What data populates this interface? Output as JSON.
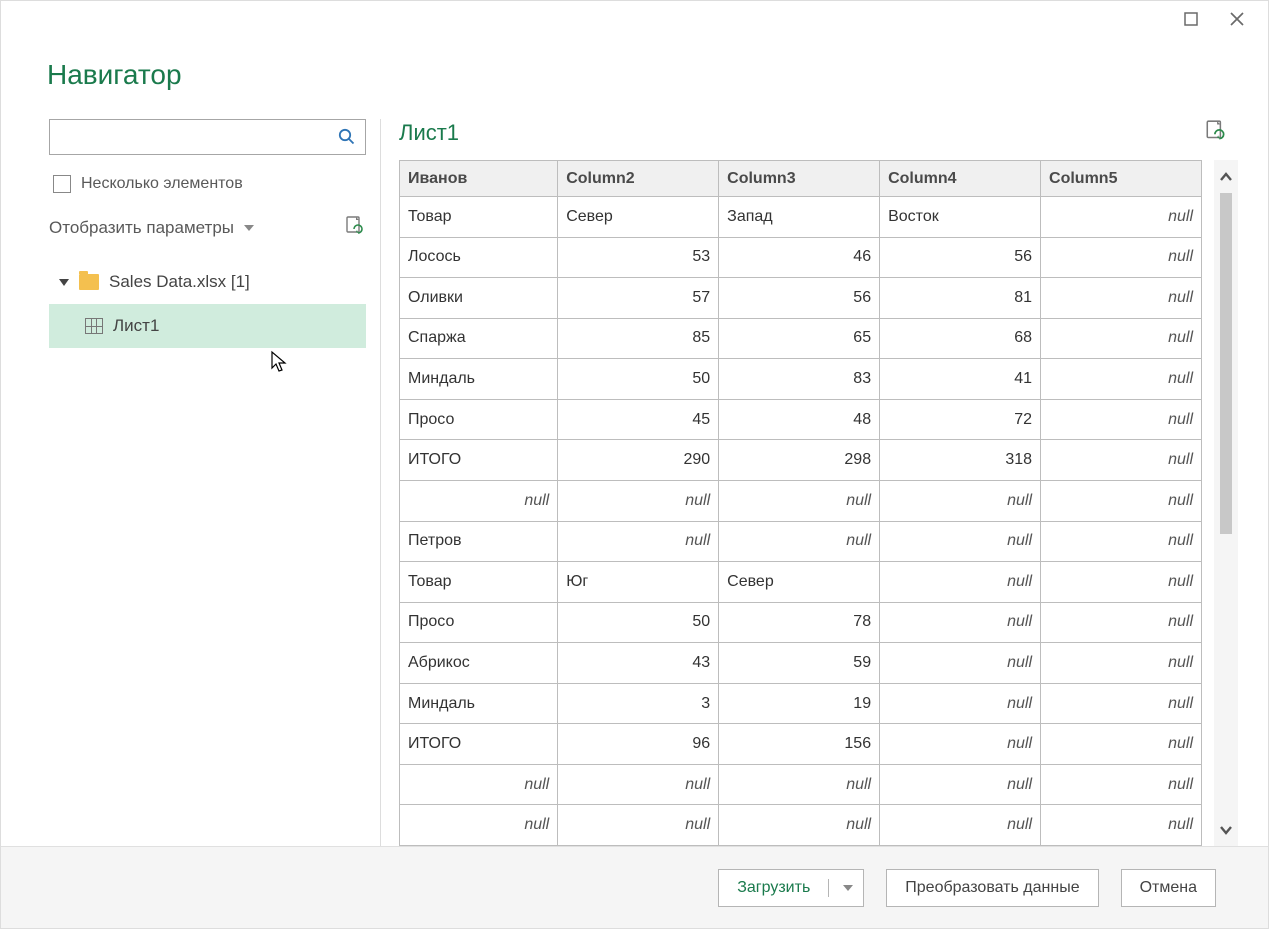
{
  "window": {
    "title": "Навигатор"
  },
  "sidebar": {
    "search_placeholder": "",
    "multi_select_label": "Несколько элементов",
    "display_options_label": "Отобразить параметры",
    "tree": {
      "root_label": "Sales Data.xlsx [1]",
      "sheets": [
        "Лист1"
      ]
    }
  },
  "preview": {
    "title": "Лист1",
    "null_text": "null",
    "columns": [
      "Иванов",
      "Column2",
      "Column3",
      "Column4",
      "Column5"
    ],
    "rows": [
      {
        "c": [
          "Товар",
          "Север",
          "Запад",
          "Восток",
          null
        ],
        "t": [
          "s",
          "s",
          "s",
          "s",
          "n"
        ]
      },
      {
        "c": [
          "Лосось",
          53,
          46,
          56,
          null
        ],
        "t": [
          "s",
          "r",
          "r",
          "r",
          "n"
        ]
      },
      {
        "c": [
          "Оливки",
          57,
          56,
          81,
          null
        ],
        "t": [
          "s",
          "r",
          "r",
          "r",
          "n"
        ]
      },
      {
        "c": [
          "Спаржа",
          85,
          65,
          68,
          null
        ],
        "t": [
          "s",
          "r",
          "r",
          "r",
          "n"
        ]
      },
      {
        "c": [
          "Миндаль",
          50,
          83,
          41,
          null
        ],
        "t": [
          "s",
          "r",
          "r",
          "r",
          "n"
        ]
      },
      {
        "c": [
          "Просо",
          45,
          48,
          72,
          null
        ],
        "t": [
          "s",
          "r",
          "r",
          "r",
          "n"
        ]
      },
      {
        "c": [
          "ИТОГО",
          290,
          298,
          318,
          null
        ],
        "t": [
          "s",
          "r",
          "r",
          "r",
          "n"
        ]
      },
      {
        "c": [
          null,
          null,
          null,
          null,
          null
        ],
        "t": [
          "n",
          "n",
          "n",
          "n",
          "n"
        ]
      },
      {
        "c": [
          "Петров",
          null,
          null,
          null,
          null
        ],
        "t": [
          "s",
          "n",
          "n",
          "n",
          "n"
        ]
      },
      {
        "c": [
          "Товар",
          "Юг",
          "Север",
          null,
          null
        ],
        "t": [
          "s",
          "s",
          "s",
          "n",
          "n"
        ]
      },
      {
        "c": [
          "Просо",
          50,
          78,
          null,
          null
        ],
        "t": [
          "s",
          "r",
          "r",
          "n",
          "n"
        ]
      },
      {
        "c": [
          "Абрикос",
          43,
          59,
          null,
          null
        ],
        "t": [
          "s",
          "r",
          "r",
          "n",
          "n"
        ]
      },
      {
        "c": [
          "Миндаль",
          3,
          19,
          null,
          null
        ],
        "t": [
          "s",
          "r",
          "r",
          "n",
          "n"
        ]
      },
      {
        "c": [
          "ИТОГО",
          96,
          156,
          null,
          null
        ],
        "t": [
          "s",
          "r",
          "r",
          "n",
          "n"
        ]
      },
      {
        "c": [
          null,
          null,
          null,
          null,
          null
        ],
        "t": [
          "n",
          "n",
          "n",
          "n",
          "n"
        ]
      },
      {
        "c": [
          null,
          null,
          null,
          null,
          null
        ],
        "t": [
          "n",
          "n",
          "n",
          "n",
          "n"
        ]
      }
    ]
  },
  "footer": {
    "load_label": "Загрузить",
    "transform_label": "Преобразовать данные",
    "cancel_label": "Отмена"
  }
}
